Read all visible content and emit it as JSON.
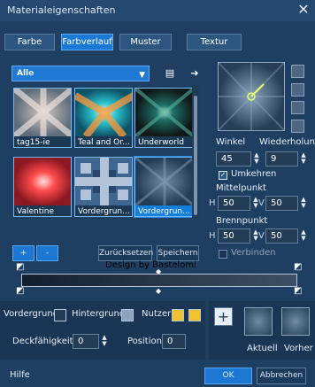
{
  "window": {
    "title": "Materialeigenschaften",
    "close_glyph": "✕"
  },
  "tabs": [
    {
      "label": "Farbe",
      "active": false
    },
    {
      "label": "Farbverlauf",
      "active": true
    },
    {
      "label": "Muster",
      "active": false
    },
    {
      "label": "Textur",
      "active": false
    }
  ],
  "gradient_list": {
    "filter_value": "Alle",
    "items": [
      {
        "label": "tag15-ie",
        "style": "radial-gray"
      },
      {
        "label": "Teal and Or...",
        "style": "teal-orange"
      },
      {
        "label": "Underworld",
        "style": "underworld"
      },
      {
        "label": "Valentine",
        "style": "valentine"
      },
      {
        "label": "Vordergrun...",
        "style": "blue-cross"
      },
      {
        "label": "Vordergrun...",
        "style": "foreground",
        "selected": true
      }
    ],
    "buttons": {
      "plus": "+",
      "minus": "-",
      "reset": "Zurücksetzen",
      "save": "Speichern"
    }
  },
  "gradient_settings": {
    "winkel_label": "Winkel",
    "winkel_value": "45",
    "wiederholung_label": "Wiederholung",
    "wiederholung_value": "9",
    "umkehren_label": "Umkehren",
    "umkehren_checked": true,
    "mittelpunkt_label": "Mittelpunkt",
    "mittel_h_label": "H",
    "mittel_h": "50",
    "mittel_v_label": "V",
    "mittel_v": "50",
    "brennpunkt_label": "Brennpunkt",
    "brenn_h_label": "H",
    "brenn_h": "50",
    "brenn_v_label": "V",
    "brenn_v": "50",
    "verbinden_label": "Verbinden",
    "verbinden_checked": false
  },
  "overlay_text": "Design by Bastelomi",
  "colors": {
    "accent": "#1c78d6",
    "panel": "#1f3f62",
    "nutzer_color": "#f2c230"
  },
  "bottom": {
    "vordergrund_label": "Vordergrund:",
    "hintergrund_label": "Hintergrund:",
    "nutzer_label": "Nutzer:",
    "deckfaehigkeit_label": "Deckfähigkeit:",
    "deckfaehigkeit_value": "0",
    "position_label": "Position:",
    "position_value": "0",
    "add_label": "+",
    "aktuell_label": "Aktuell",
    "vorher_label": "Vorher"
  },
  "footer": {
    "help": "Hilfe",
    "ok": "OK",
    "cancel": "Abbrechen"
  }
}
